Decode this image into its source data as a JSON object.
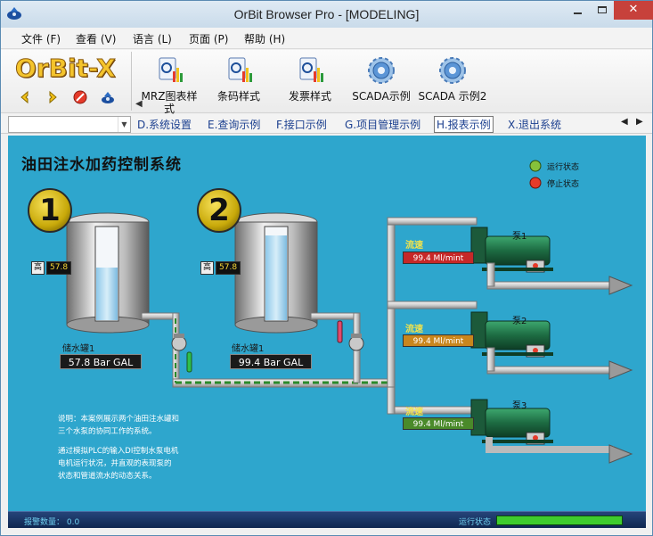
{
  "window": {
    "title": "OrBit Browser Pro - [MODELING]",
    "close": "✕"
  },
  "menu": [
    "文件 (F)",
    "查看 (V)",
    "语言 (L)",
    "页面 (P)",
    "帮助 (H)"
  ],
  "toolbar": {
    "logo": "OrBit-X",
    "buttons": [
      "MRZ图表样式",
      "条码样式",
      "发票样式",
      "SCADA示例",
      "SCADA 示例2"
    ]
  },
  "tabs": [
    "D.系统设置",
    "E.查询示例",
    "F.接口示例",
    "G.项目管理示例",
    "H.报表示例",
    "X.退出系统"
  ],
  "tab_active": "H.报表示例",
  "scada": {
    "title": "油田注水加药控制系统",
    "legend": {
      "running": "运行状态",
      "stopped": "停止状态"
    },
    "tanks": [
      {
        "badge": "1",
        "hi_label": "高",
        "hi_value": "57.8",
        "name": "储水罐1",
        "value": "57.8  Bar GAL",
        "level_pct": 55
      },
      {
        "badge": "2",
        "hi_label": "高",
        "hi_value": "57.8",
        "name": "储水罐1",
        "value": "99.4  Bar GAL",
        "level_pct": 90
      }
    ],
    "pumps": [
      {
        "flow_label": "流速",
        "flow_value": "99.4  Ml/mint",
        "name": "泵1",
        "flow_color": "#c62828"
      },
      {
        "flow_label": "流速",
        "flow_value": "99.4  Ml/mint",
        "name": "泵2",
        "flow_color": "#c9861d"
      },
      {
        "flow_label": "流速",
        "flow_value": "99.4  Ml/mint",
        "name": "泵3",
        "flow_color": "#4a8a2a"
      }
    ],
    "note_lines": [
      "说明：本案例展示两个油田注水罐和",
      "三个水泵的协同工作的系统。",
      "",
      "通过模拟PLC的输入DI控制水泵电机",
      "电机运行状况，并直观的表现泵的",
      "状态和管道流水的动态关系。"
    ],
    "status": {
      "alarm": "报警数量： 0.0",
      "run_state": "运行状态",
      "run_level_pct": 100
    }
  }
}
